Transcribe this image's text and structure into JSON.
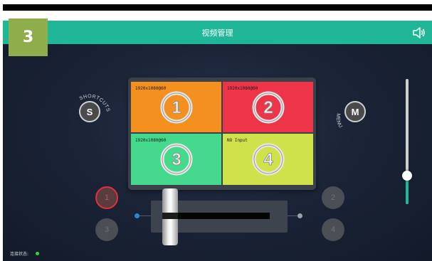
{
  "header": {
    "title": "视频管理",
    "volume_icon": "speaker-icon"
  },
  "step_badge": "3",
  "monitor": {
    "cells": [
      {
        "label": "1920x1080@60",
        "digit": "1",
        "color": "#f49020"
      },
      {
        "label": "1920x1080@60",
        "digit": "2",
        "color": "#ee3448"
      },
      {
        "label": "1920x1080@60",
        "digit": "3",
        "color": "#45d98d"
      },
      {
        "label": "NO Input",
        "digit": "4",
        "color": "#cfe24a"
      }
    ]
  },
  "shortcut": {
    "button": "S",
    "caption": "SHORTCUTS"
  },
  "menu": {
    "button": "M",
    "caption": "MENU"
  },
  "sources": {
    "left": [
      "1",
      "3"
    ],
    "right": [
      "2",
      "4"
    ],
    "selected": "1"
  },
  "volume": {
    "level": 0.23
  },
  "status": {
    "label": "连接状态:",
    "connected_color": "#36d23a"
  },
  "colors": {
    "accent": "#20b798",
    "badge": "#8fad4b"
  }
}
